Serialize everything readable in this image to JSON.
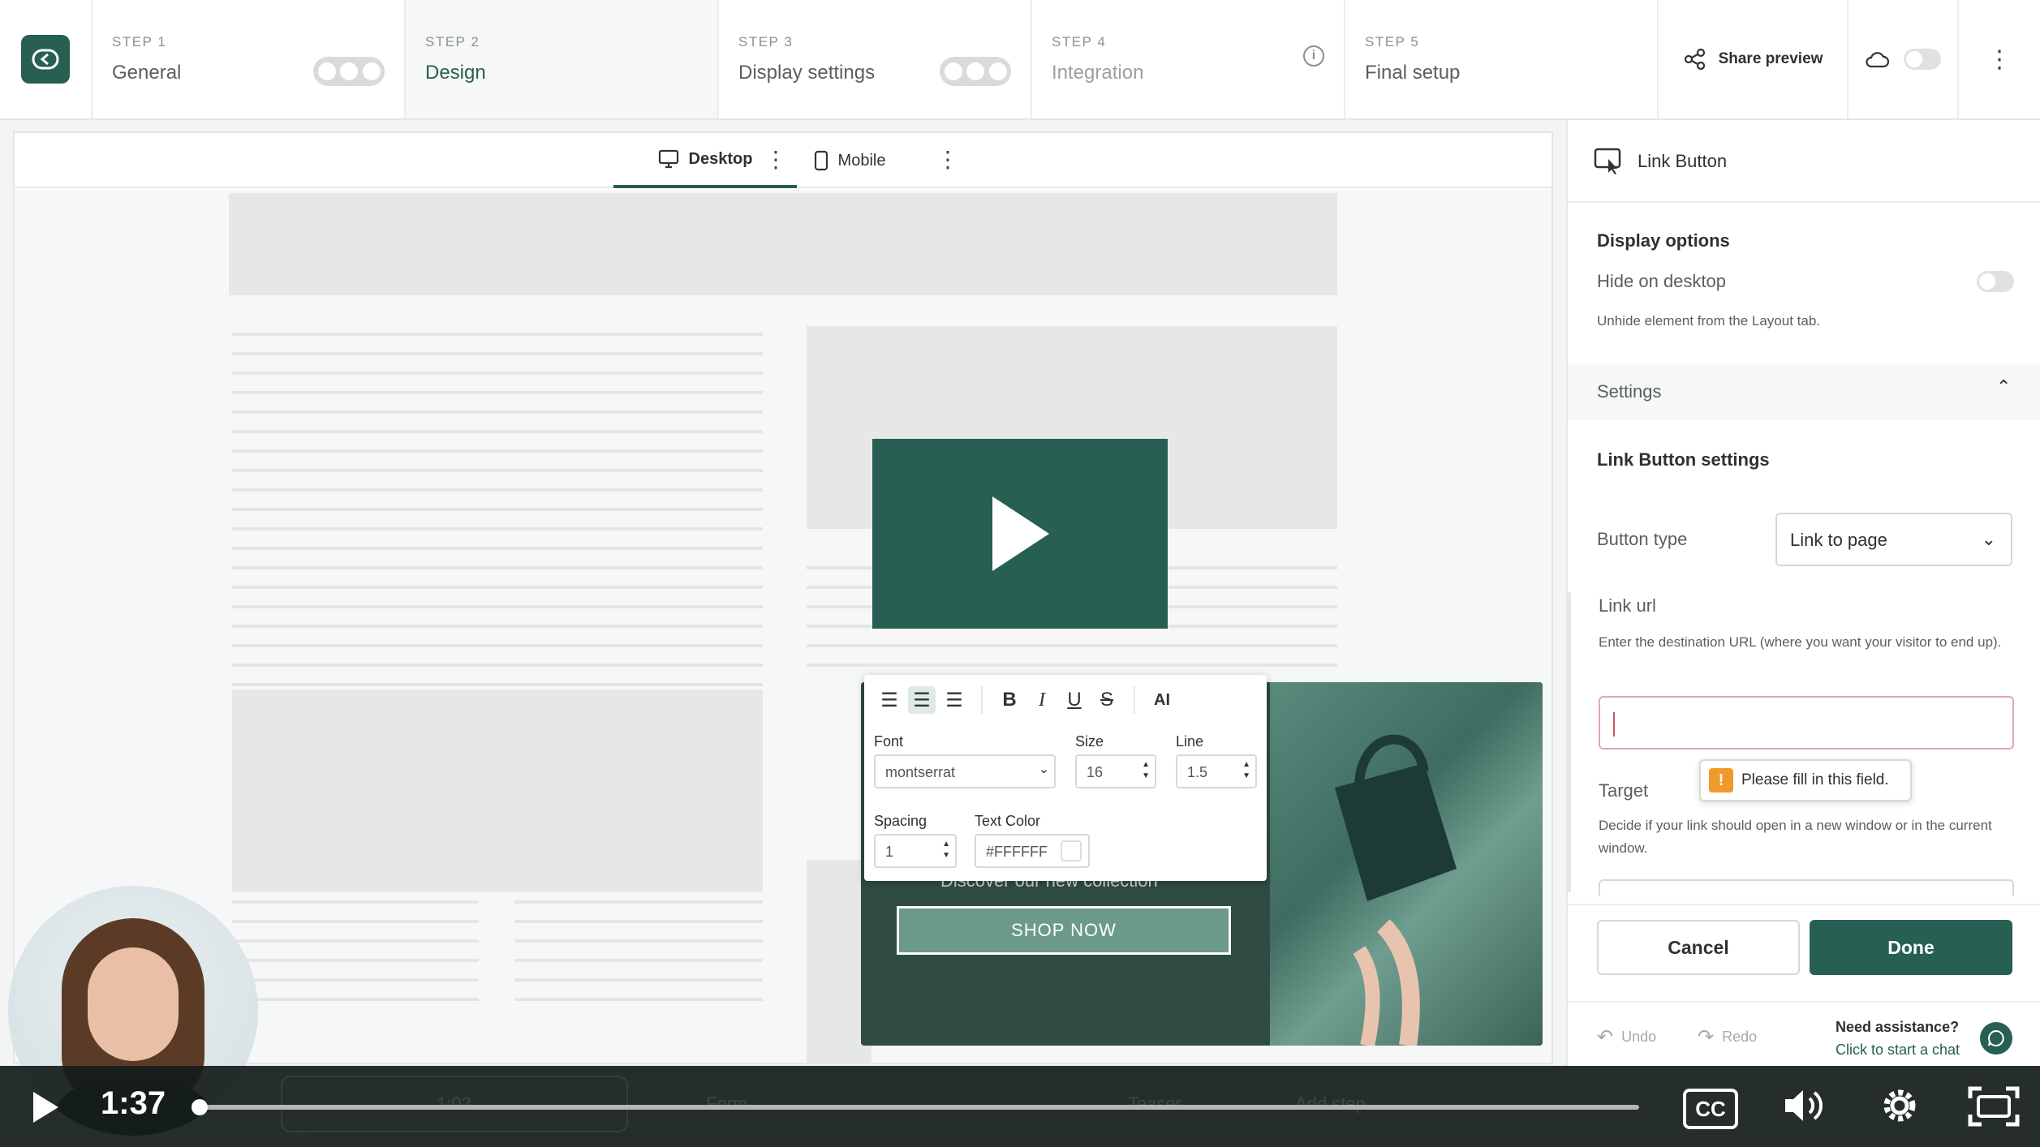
{
  "steps": [
    {
      "num": "STEP 1",
      "name": "General"
    },
    {
      "num": "STEP 2",
      "name": "Design"
    },
    {
      "num": "STEP 3",
      "name": "Display settings"
    },
    {
      "num": "STEP 4",
      "name": "Integration"
    },
    {
      "num": "STEP 5",
      "name": "Final setup"
    }
  ],
  "topbar": {
    "share_label": "Share preview",
    "logo_icon": "back-arrow-icon",
    "more_icon": "vertical-dots-icon"
  },
  "viewbar": {
    "desktop": "Desktop",
    "mobile": "Mobile"
  },
  "banner": {
    "tagline": "Discover our new collection",
    "cta": "SHOP NOW"
  },
  "format_toolbar": {
    "font_label": "Font",
    "font_value": "montserrat",
    "size_label": "Size",
    "size_value": "16",
    "line_label": "Line",
    "line_value": "1.5",
    "spacing_label": "Spacing",
    "spacing_value": "1",
    "color_label": "Text Color",
    "color_value": "#FFFFFF",
    "ai_label": "AI"
  },
  "panel": {
    "title": "Link Button",
    "display_options": "Display options",
    "hide_on_desktop": "Hide on desktop",
    "hide_help": "Unhide element from the Layout tab.",
    "settings": "Settings",
    "link_settings": "Link Button settings",
    "button_type_label": "Button type",
    "button_type_value": "Link to page",
    "link_url_label": "Link url",
    "link_url_help": "Enter the destination URL (where you want your visitor to end up).",
    "tooltip": "Please fill in this field.",
    "target_label": "Target",
    "target_help": "Decide if your link should open in a new window or in the current window.",
    "cancel": "Cancel",
    "done": "Done",
    "undo": "Undo",
    "redo": "Redo",
    "assist_title": "Need assistance?",
    "assist_link": "Click to start a chat"
  },
  "player": {
    "time": "1:37",
    "progress": 0.0,
    "cc": "CC",
    "ghost": {
      "time": "1:02",
      "form": "Form",
      "teaser": "Teaser",
      "add_step": "Add step"
    }
  },
  "colors": {
    "brand": "#275f52",
    "error_border": "#e3a7ae",
    "warning": "#f09a2b"
  }
}
